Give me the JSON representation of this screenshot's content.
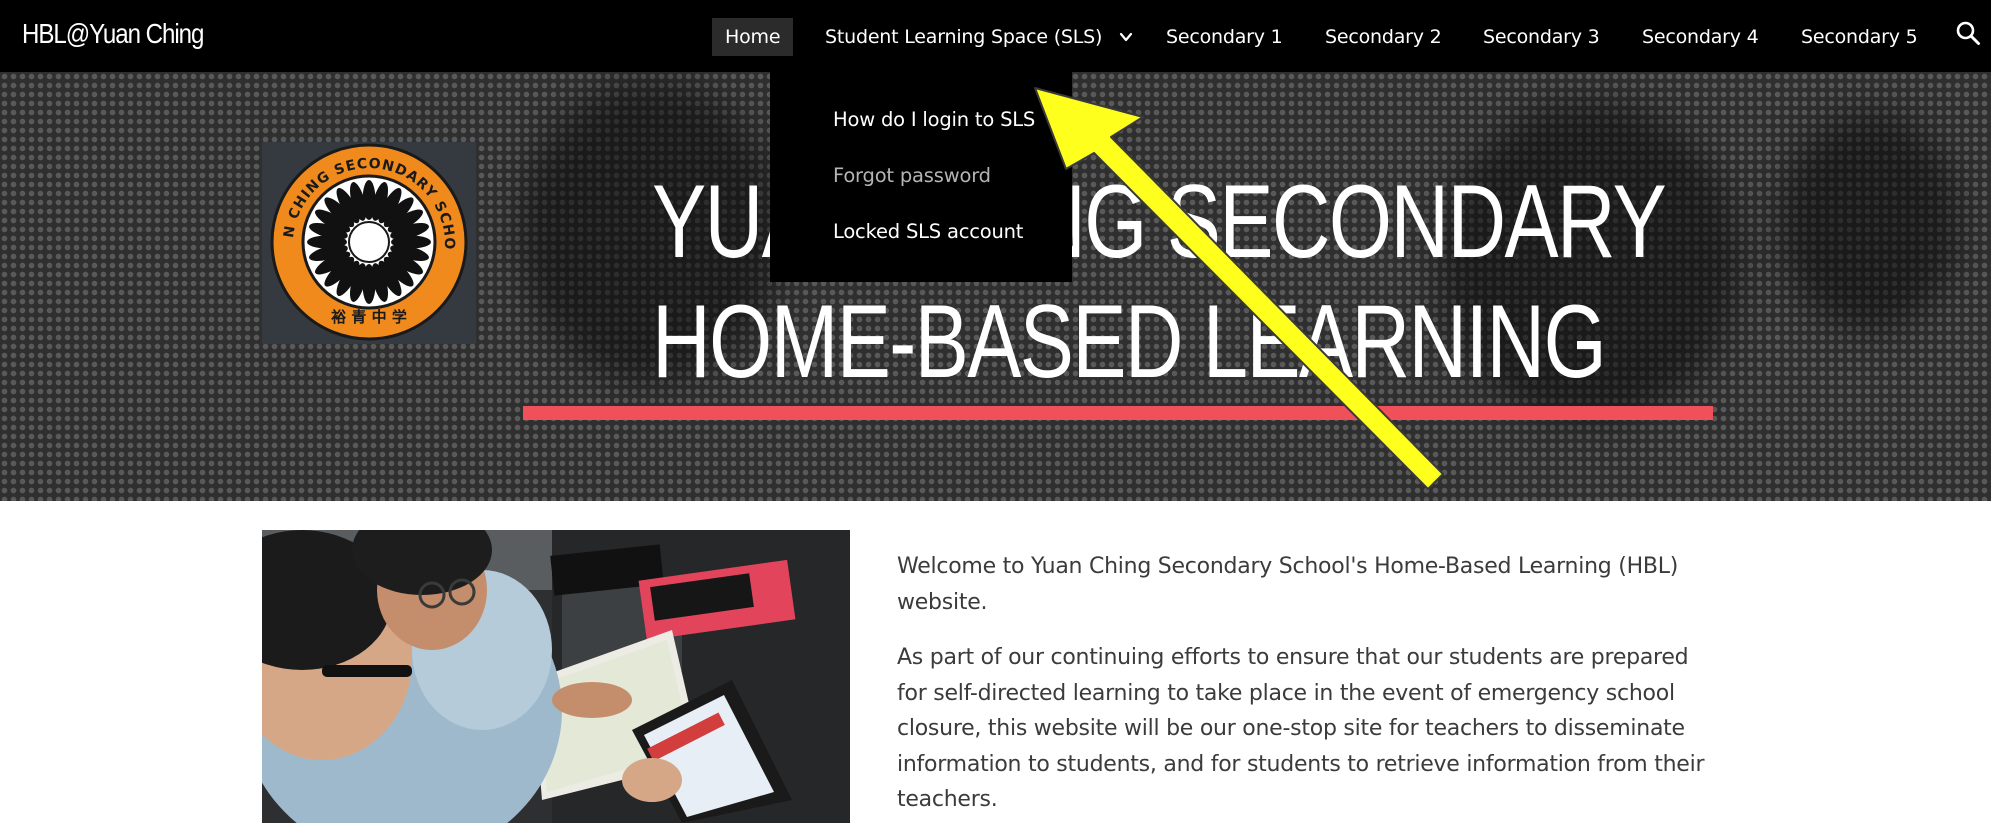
{
  "site": {
    "title": "HBL@Yuan Ching"
  },
  "nav": {
    "items": [
      {
        "label": "Home",
        "active": true
      },
      {
        "label": "Student Learning Space (SLS)",
        "has_submenu": true
      },
      {
        "label": "Secondary 1"
      },
      {
        "label": "Secondary 2"
      },
      {
        "label": "Secondary 3"
      },
      {
        "label": "Secondary 4"
      },
      {
        "label": "Secondary 5"
      }
    ],
    "search_icon": "search-icon",
    "submenu_icon": "chevron-down-icon"
  },
  "dropdown": {
    "items": [
      {
        "label": "How do I login to SLS",
        "highlighted": true
      },
      {
        "label": "Forgot password",
        "highlighted": false
      },
      {
        "label": "Locked SLS account",
        "highlighted": true
      }
    ]
  },
  "hero": {
    "title_line1": "YUAN CHING SECONDARY",
    "title_line2": "HOME-BASED LEARNING",
    "logo": {
      "ring_text": "YUAN CHING SECONDARY SCHOOL",
      "motto_chars": "裕 青 中 学"
    },
    "underline_color": "#f0505a"
  },
  "annotation": {
    "type": "arrow",
    "color": "#ffff1e",
    "points_to": "How do I login to SLS"
  },
  "content": {
    "welcome": "Welcome to Yuan Ching Secondary School's Home-Based Learning (HBL) website.",
    "paragraph": "As part of our continuing efforts to ensure that our students are prepared for self-directed learning to take place in the event of emergency school closure, this website will be our one-stop site for teachers to disseminate information to students, and for students to retrieve information from their teachers."
  },
  "colors": {
    "nav_bg": "#000000",
    "nav_active_bg": "#2b2b2b",
    "submenu_dim_text": "#b4b4b4",
    "body_text": "#3b3b3b",
    "logo_orange": "#f08a1c"
  }
}
